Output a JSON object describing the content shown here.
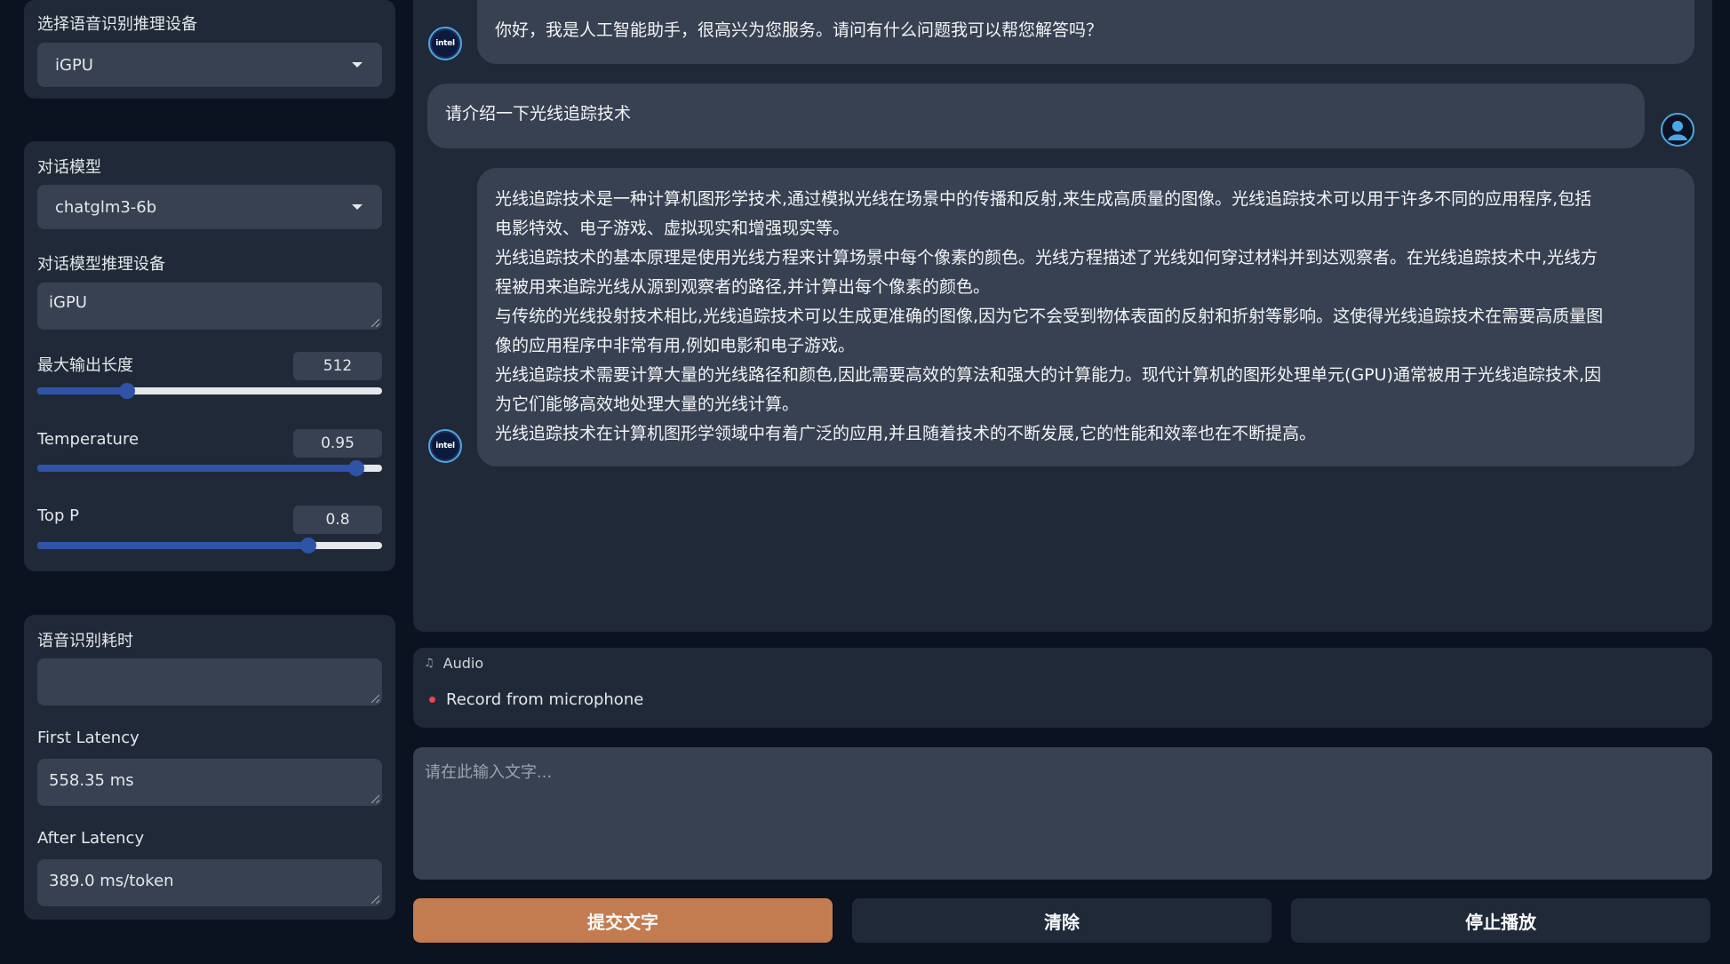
{
  "sidebar": {
    "asr_device": {
      "label": "选择语音识别推理设备",
      "value": "iGPU"
    },
    "chat_model": {
      "label": "对话模型",
      "value": "chatglm3-6b"
    },
    "chat_device": {
      "label": "对话模型推理设备",
      "value": "iGPU"
    },
    "max_length": {
      "label": "最大输出长度",
      "value": "512",
      "fraction": 0.26
    },
    "temperature": {
      "label": "Temperature",
      "value": "0.95",
      "fraction": 0.925
    },
    "top_p": {
      "label": "Top P",
      "value": "0.8",
      "fraction": 0.785
    },
    "asr_time": {
      "label": "语音识别耗时",
      "value": ""
    },
    "first_latency": {
      "label": "First Latency",
      "value": "558.35 ms"
    },
    "after_latency": {
      "label": "After Latency",
      "value": "389.0 ms/token"
    }
  },
  "chat": {
    "bot_avatar_text": "intel",
    "greeting": "你好，我是人工智能助手，很高兴为您服务。请问有什么问题我可以帮您解答吗？",
    "user_message": "请介绍一下光线追踪技术",
    "answer_lines": [
      "光线追踪技术是一种计算机图形学技术,通过模拟光线在场景中的传播和反射,来生成高质量的图像。光线追踪技术可以用于许多不同的应用程序,包括",
      "电影特效、电子游戏、虚拟现实和增强现实等。",
      "光线追踪技术的基本原理是使用光线方程来计算场景中每个像素的颜色。光线方程描述了光线如何穿过材料并到达观察者。在光线追踪技术中,光线方",
      "程被用来追踪光线从源到观察者的路径,并计算出每个像素的颜色。",
      "与传统的光线投射技术相比,光线追踪技术可以生成更准确的图像,因为它不会受到物体表面的反射和折射等影响。这使得光线追踪技术在需要高质量图",
      "像的应用程序中非常有用,例如电影和电子游戏。",
      "光线追踪技术需要计算大量的光线路径和颜色,因此需要高效的算法和强大的计算能力。现代计算机的图形处理单元(GPU)通常被用于光线追踪技术,因",
      "为它们能够高效地处理大量的光线计算。",
      "光线追踪技术在计算机图形学领域中有着广泛的应用,并且随着技术的不断发展,它的性能和效率也在不断提高。"
    ]
  },
  "audio": {
    "label": "Audio",
    "icon": "music-note-icon",
    "record_label": "Record from microphone"
  },
  "input": {
    "placeholder": "请在此输入文字..."
  },
  "buttons": {
    "submit": "提交文字",
    "clear": "清除",
    "stop": "停止播放"
  },
  "colors": {
    "accent": "#c27c50",
    "slider": "#2f53a7",
    "panel": "#1f2937",
    "field": "#374151",
    "background": "#0b1220"
  }
}
